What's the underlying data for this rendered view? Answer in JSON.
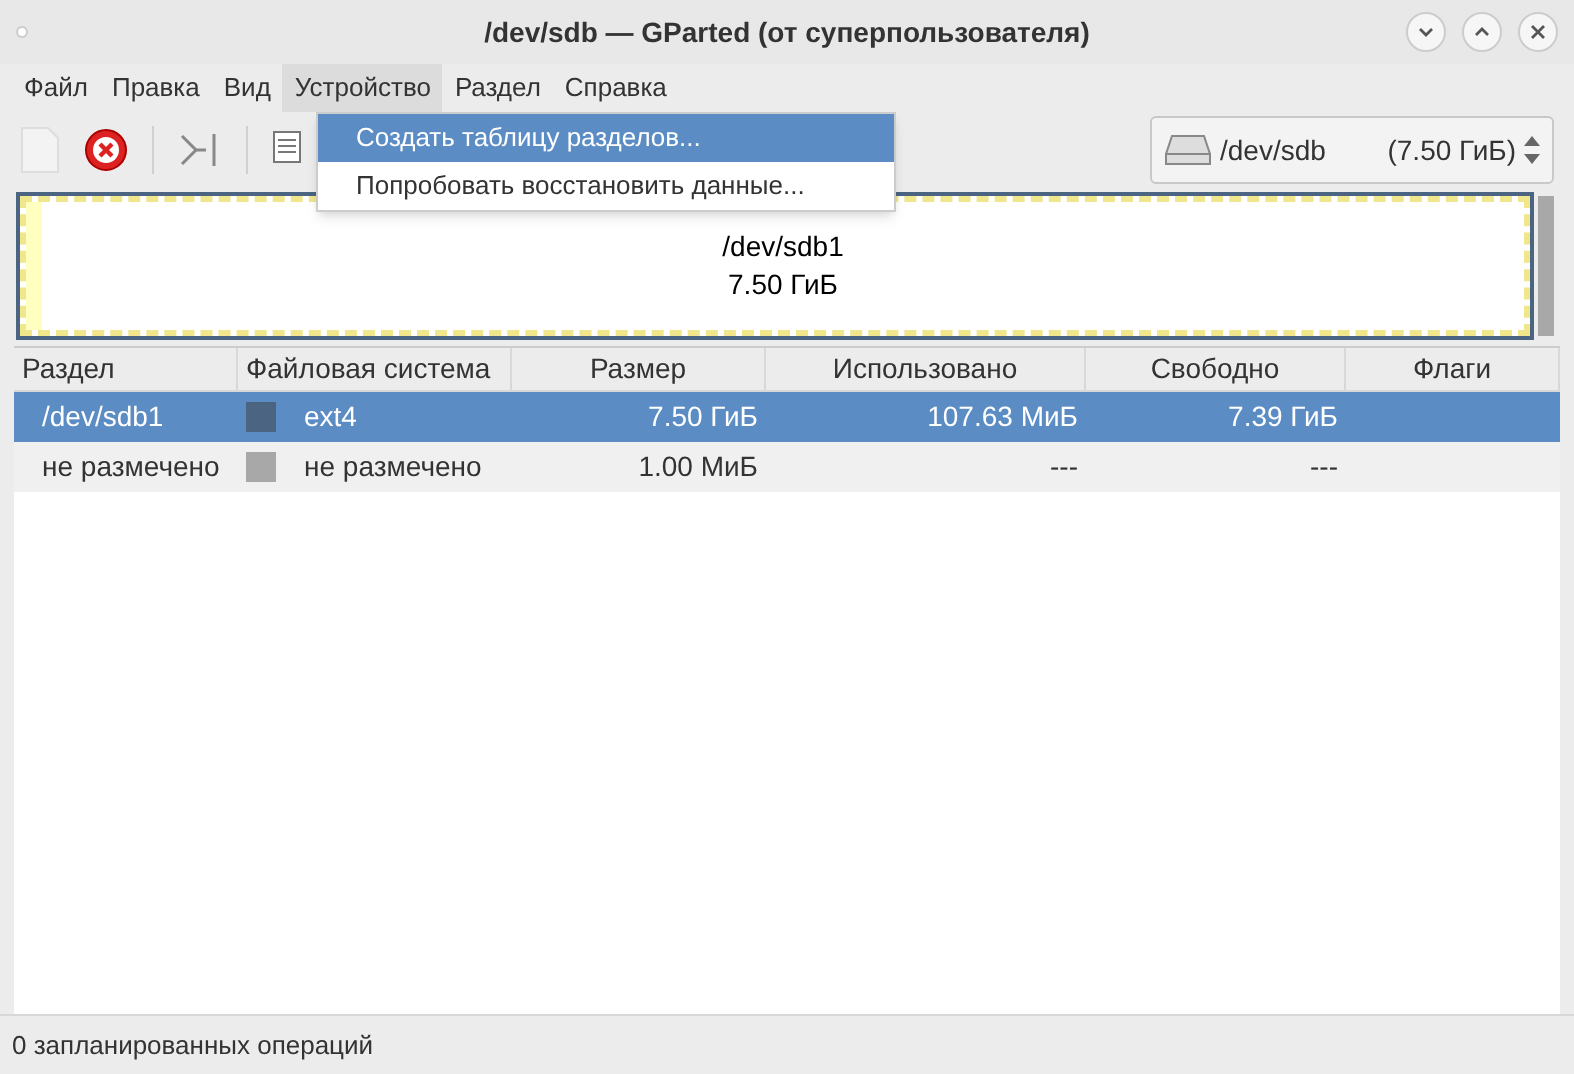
{
  "window": {
    "title": "/dev/sdb — GParted (от суперпользователя)"
  },
  "menubar": [
    {
      "label": "Файл",
      "selected": false
    },
    {
      "label": "Правка",
      "selected": false
    },
    {
      "label": "Вид",
      "selected": false
    },
    {
      "label": "Устройство",
      "selected": true
    },
    {
      "label": "Раздел",
      "selected": false
    },
    {
      "label": "Справка",
      "selected": false
    }
  ],
  "dropdown_menu": [
    {
      "label": "Создать таблицу разделов...",
      "selected": true
    },
    {
      "label": "Попробовать восстановить данные...",
      "selected": false
    }
  ],
  "device_selector": {
    "device": "/dev/sdb",
    "size": "(7.50 ГиБ)"
  },
  "disk_map": {
    "partition": "/dev/sdb1",
    "size": "7.50 ГиБ"
  },
  "table": {
    "columns": [
      "Раздел",
      "Файловая система",
      "Размер",
      "Использовано",
      "Свободно",
      "Флаги"
    ],
    "rows": [
      {
        "selected": true,
        "partition": "/dev/sdb1",
        "color": "#4a6482",
        "filesystem": "ext4",
        "size": "7.50 ГиБ",
        "used": "107.63 МиБ",
        "free": "7.39 ГиБ"
      },
      {
        "selected": false,
        "partition": "не размечено",
        "color": "#a8a8a8",
        "filesystem": "не размечено",
        "size": "1.00 МиБ",
        "used": "---",
        "free": "---"
      }
    ]
  },
  "status_bar": "0 запланированных операций"
}
